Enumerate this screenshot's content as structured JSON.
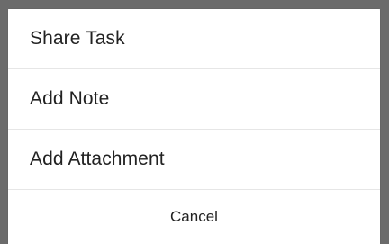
{
  "action_sheet": {
    "items": [
      {
        "label": "Share Task"
      },
      {
        "label": "Add Note"
      },
      {
        "label": "Add Attachment"
      }
    ],
    "cancel_label": "Cancel"
  },
  "colors": {
    "text": "#222222",
    "divider": "#e6e6e6",
    "background": "#ffffff",
    "scrim": "#6b6b6b"
  }
}
